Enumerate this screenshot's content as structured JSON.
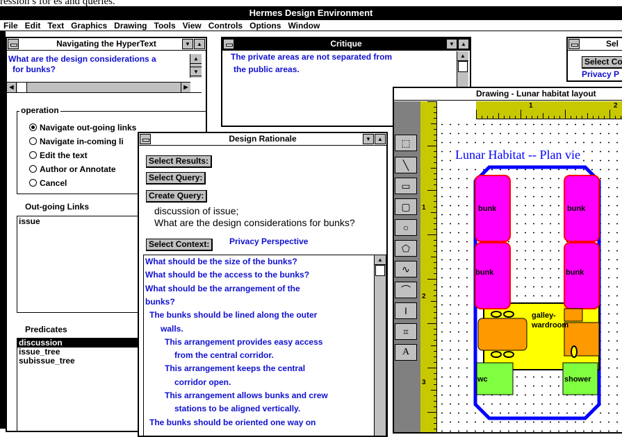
{
  "top_strip_text": "ression s    for      es and queries.",
  "app_title": "Hermes Design Environment",
  "menu": [
    "File",
    "Edit",
    "Text",
    "Graphics",
    "Drawing",
    "Tools",
    "View",
    "Controls",
    "Options",
    "Window"
  ],
  "nav_window": {
    "title": "Navigating the HyperText",
    "question_line1": "What are the design considerations a",
    "question_line2": "for bunks?",
    "operation_label": "operation",
    "options": [
      "Navigate out-going links",
      "Navigate in-coming li",
      "Edit the text",
      "Author or Annotate",
      "Cancel"
    ],
    "selected_option": 0,
    "outgoing_label": "Out-going Links",
    "outgoing_items": [
      "issue"
    ],
    "predicates_label": "Predicates",
    "predicates_items": [
      "discussion",
      "issue_tree",
      "subissue_tree"
    ],
    "selected_predicate": 0
  },
  "critique_window": {
    "title": "Critique",
    "text_line1": "The private areas are not separated from",
    "text_line2": "the public areas."
  },
  "select_window": {
    "title": "Sel",
    "button": "Select Co",
    "link": "Privacy P"
  },
  "rationale_window": {
    "title": "Design Rationale",
    "buttons": [
      "Select Results:",
      "Select Query:",
      "Create Query:"
    ],
    "query_line1": "discussion of issue;",
    "query_line2": "What are the design considerations for bunks?",
    "context_button": "Select Context:",
    "context_value": "Privacy Perspective",
    "items": [
      {
        "text": "What should be the size of the bunks?",
        "indent": 0
      },
      {
        "text": "What should be the access to the bunks?",
        "indent": 0
      },
      {
        "text": "What should be the arrangement of the",
        "indent": 0
      },
      {
        "text": "bunks?",
        "indent": 1
      },
      {
        "text": "The bunks should be lined along the outer",
        "indent": 2
      },
      {
        "text": "walls.",
        "indent": 3
      },
      {
        "text": "This arrangement provides easy access",
        "indent": 4
      },
      {
        "text": "from the central corridor.",
        "indent": 5
      },
      {
        "text": "This arrangement keeps the central",
        "indent": 4
      },
      {
        "text": "corridor open.",
        "indent": 5
      },
      {
        "text": "This arrangement allows bunks and crew",
        "indent": 4
      },
      {
        "text": "stations to be aligned vertically.",
        "indent": 5
      },
      {
        "text": "The bunks should be oriented one way on",
        "indent": 2
      }
    ]
  },
  "drawing_window": {
    "title": "Drawing - Lunar habitat layout",
    "ruler_h": [
      "1",
      "2"
    ],
    "ruler_v": [
      "1",
      "2",
      "3"
    ],
    "heading": "Lunar Habitat  --  Plan vie",
    "labels": {
      "bunk_tl": "bunk",
      "bunk_tr": "bunk",
      "bunk_ml": "bunk",
      "bunk_mr": "bunk",
      "galley_1": "galley-",
      "galley_2": "wardroom",
      "wc": "wc",
      "shower": "shower"
    },
    "colors": {
      "hull": "#0000ff",
      "bunk": "#ff00ff",
      "galley": "#ffff00",
      "table": "#ff9900",
      "wc": "#80ff40",
      "ruler": "#c8c800"
    }
  },
  "toolbar_icons": [
    "select-icon",
    "line-icon",
    "rectangle-icon",
    "rounded-rect-icon",
    "circle-icon",
    "polygon-icon",
    "freehand-icon",
    "curve-icon",
    "text-cursor-icon",
    "crop-icon",
    "text-icon"
  ]
}
